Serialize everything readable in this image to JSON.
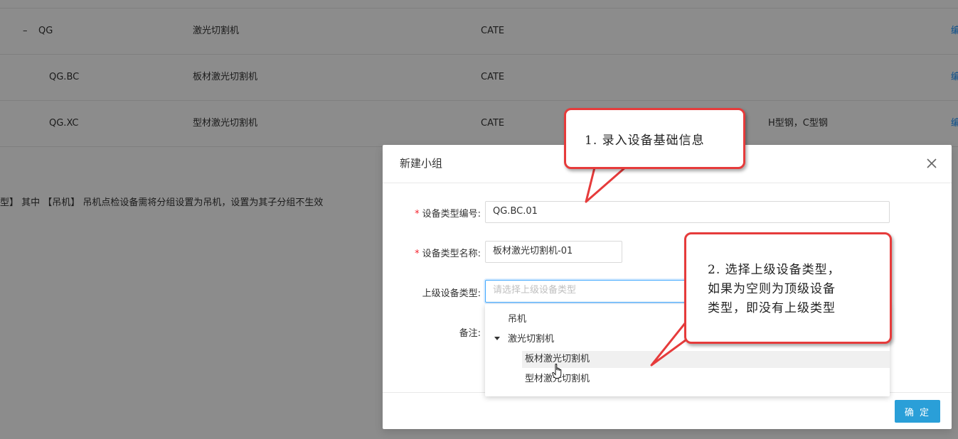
{
  "table": {
    "rows": [
      {
        "code": "QG",
        "name": "激光切割机",
        "cate": "CATE",
        "extra": "",
        "action": "编"
      },
      {
        "code": "QG.BC",
        "name": "板材激光切割机",
        "cate": "CATE",
        "extra": "",
        "action": "编"
      },
      {
        "code": "QG.XC",
        "name": "型材激光切割机",
        "cate": "CATE",
        "extra": "H型钢，C型钢",
        "action": "编"
      }
    ],
    "collapse_symbol": "–"
  },
  "notice": "型】 其中 【吊机】 吊机点检设备需将分组设置为吊机，设置为其子分组不生效",
  "modal": {
    "title": "新建小组",
    "fields": {
      "type_code": {
        "label": "设备类型编号:",
        "value": "QG.BC.01",
        "required": true
      },
      "type_name": {
        "label": "设备类型名称:",
        "value": "板材激光切割机-01",
        "required": true
      },
      "parent_type": {
        "label": "上级设备类型:",
        "placeholder": "请选择上级设备类型",
        "value": ""
      },
      "remark": {
        "label": "备注:"
      }
    },
    "confirm_label": "确 定"
  },
  "dropdown": {
    "items": [
      {
        "label": "吊机",
        "level": 0
      },
      {
        "label": "激光切割机",
        "level": 0,
        "expanded": true
      },
      {
        "label": "板材激光切割机",
        "level": 1,
        "hovered": true
      },
      {
        "label": "型材激光切割机",
        "level": 1
      }
    ]
  },
  "callouts": {
    "step1": "1. 录入设备基础信息",
    "step2_line1": "2. 选择上级设备类型，",
    "step2_line2": "如果为空则为顶级设备",
    "step2_line3": "类型，即没有上级类型"
  },
  "colors": {
    "primary": "#2a9fd8",
    "callout_border": "#e63b3b",
    "required": "#f5222d"
  }
}
